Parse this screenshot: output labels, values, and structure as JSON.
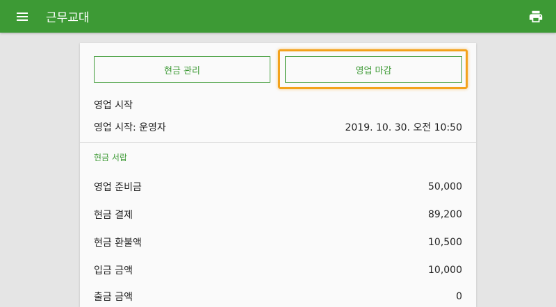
{
  "appbar": {
    "title": "근무교대",
    "menu_icon": "hamburger-menu-icon",
    "print_icon": "print-icon"
  },
  "colors": {
    "primary": "#3d9a35",
    "focus_ring": "#f3a21c",
    "background": "#e5e5e5",
    "card": "#fafafa"
  },
  "actions": {
    "cash_management": "현금 관리",
    "close_business": "영업 마감"
  },
  "business_start": {
    "heading": "영업 시작",
    "label": "영업 시작: 운영자",
    "time": "2019. 10. 30. 오전 10:50"
  },
  "cash_drawer": {
    "title": "현금 서랍",
    "rows": [
      {
        "label": "영업 준비금",
        "value": "50,000"
      },
      {
        "label": "현금 결제",
        "value": "89,200"
      },
      {
        "label": "현금 환불액",
        "value": "10,500"
      },
      {
        "label": "입금 금액",
        "value": "10,000"
      },
      {
        "label": "출금 금액",
        "value": "0"
      }
    ]
  }
}
